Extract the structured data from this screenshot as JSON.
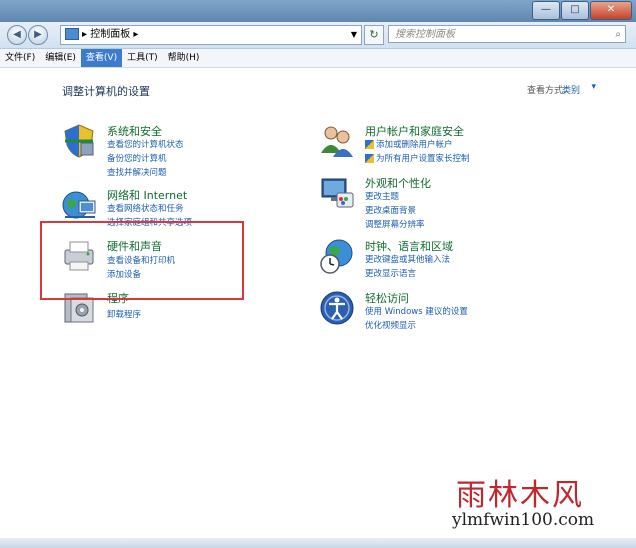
{
  "window": {
    "min_label": "—",
    "max_label": "□",
    "close_label": "✕"
  },
  "address": {
    "crumb": "▸ 控制面板 ▸",
    "search_placeholder": "搜索控制面板"
  },
  "menu": {
    "items": [
      "文件(F)",
      "编辑(E)",
      "查看(V)",
      "工具(T)",
      "帮助(H)"
    ],
    "active_index": 2
  },
  "main": {
    "heading": "调整计算机的设置",
    "view_by_label": "查看方式:",
    "view_by_value": "类别"
  },
  "categories": [
    {
      "title": "系统和安全",
      "icon": "shield-icon",
      "links": [
        "查看您的计算机状态",
        "备份您的计算机",
        "查找并解决问题"
      ]
    },
    {
      "title": "网络和 Internet",
      "icon": "network-globe-icon",
      "links": [
        "查看网络状态和任务",
        "选择家庭组和共享选项"
      ]
    },
    {
      "title": "硬件和声音",
      "icon": "printer-icon",
      "links": [
        "查看设备和打印机",
        "添加设备"
      ]
    },
    {
      "title": "程序",
      "icon": "programs-icon",
      "links": [
        "卸载程序"
      ]
    },
    {
      "title": "用户帐户和家庭安全",
      "icon": "users-icon",
      "links": [
        "添加或删除用户帐户",
        "为所有用户设置家长控制"
      ]
    },
    {
      "title": "外观和个性化",
      "icon": "appearance-icon",
      "links": [
        "更改主题",
        "更改桌面背景",
        "调整屏幕分辨率"
      ]
    },
    {
      "title": "时钟、语言和区域",
      "icon": "clock-globe-icon",
      "links": [
        "更改键盘或其他输入法",
        "更改显示语言"
      ]
    },
    {
      "title": "轻松访问",
      "icon": "ease-of-access-icon",
      "links": [
        "使用 Windows 建议的设置",
        "优化视频显示"
      ]
    }
  ],
  "watermark": {
    "chinese": "雨林木风",
    "url": "ylmfwin100.com"
  },
  "colors": {
    "link": "#1b5fb5",
    "category_title": "#0f6c2f",
    "highlight": "#d9363e"
  }
}
